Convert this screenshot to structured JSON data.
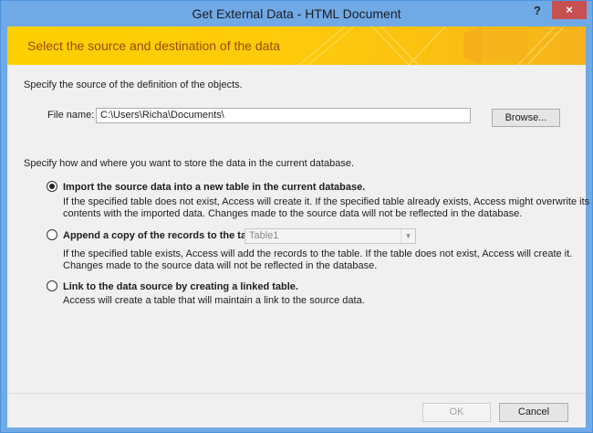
{
  "window": {
    "title": "Get External Data - HTML Document",
    "help_label": "?",
    "close_label": "×"
  },
  "banner": {
    "heading": "Select the source and destination of the data"
  },
  "source": {
    "instruction": "Specify the source of the definition of the objects.",
    "file_label": "File name:",
    "file_value": "C:\\Users\\Richa\\Documents\\",
    "browse_label": "Browse..."
  },
  "storage": {
    "instruction": "Specify how and where you want to store the data in the current database.",
    "options": [
      {
        "label": "Import the source data into a new table in the current database.",
        "selected": true,
        "desc1": "If the specified table does not exist, Access will create it. If the specified table already exists, Access might overwrite its",
        "desc2": "contents with the imported data. Changes made to the source data will not be reflected in the database."
      },
      {
        "label": "Append a copy of the records to the table:",
        "selected": false,
        "table_value": "Table1",
        "desc1": "If the specified table exists, Access will add the records to the table. If the table does not exist, Access will create it.",
        "desc2": "Changes made to the source data will not be reflected in the database."
      },
      {
        "label": "Link to the data source by creating a linked table.",
        "selected": false,
        "desc1": "Access will create a table that will maintain a link to the source data."
      }
    ]
  },
  "footer": {
    "ok_label": "OK",
    "cancel_label": "Cancel"
  }
}
